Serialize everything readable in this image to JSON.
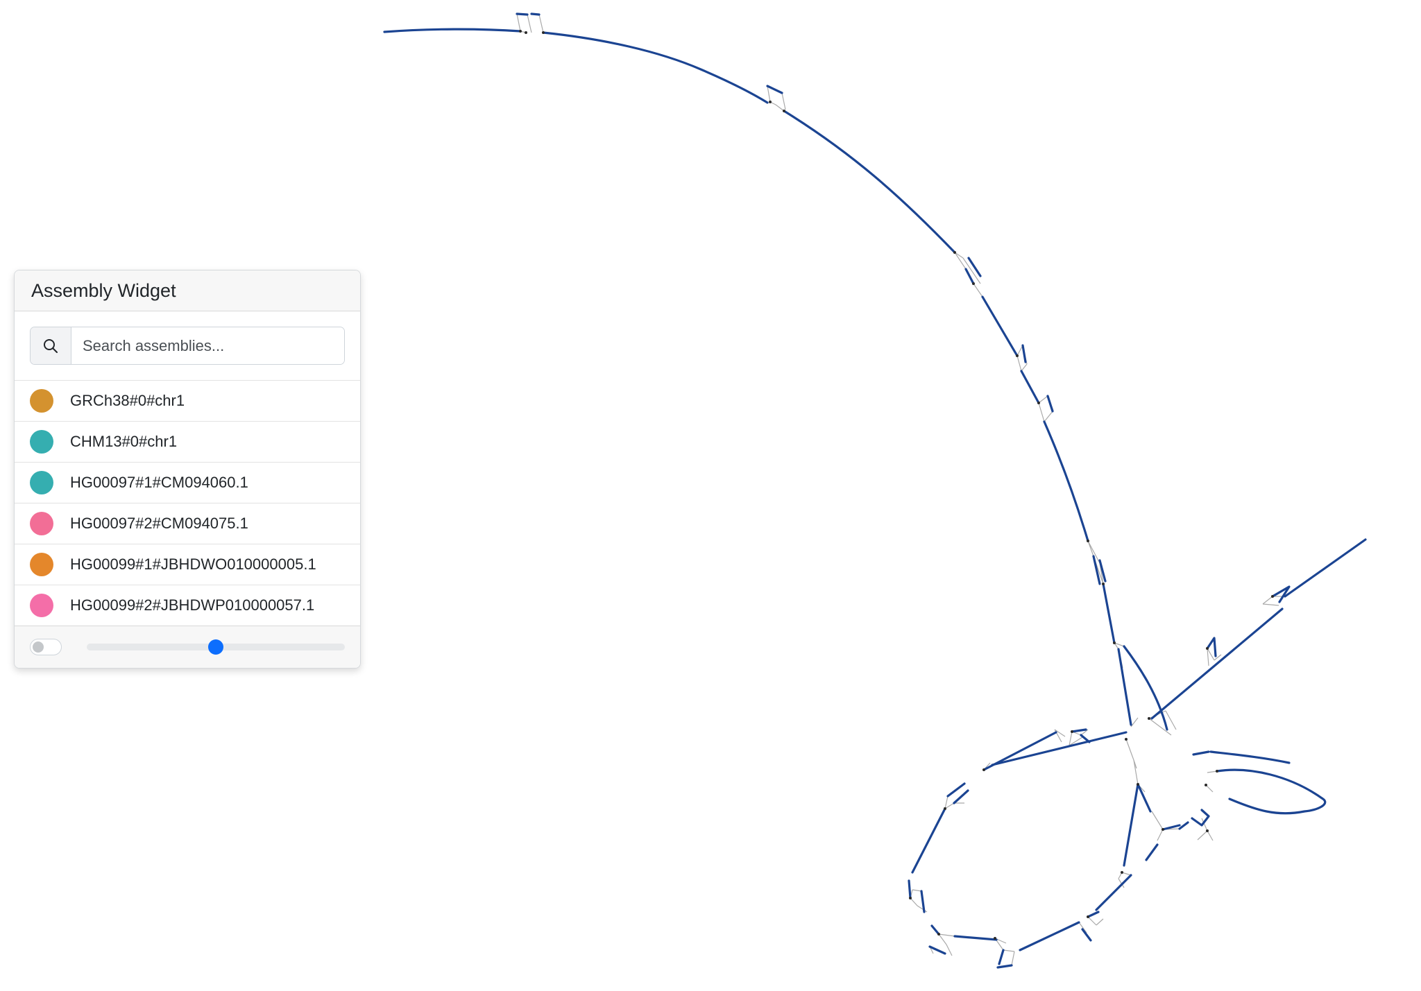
{
  "widget": {
    "title": "Assembly Widget",
    "search": {
      "placeholder": "Search assemblies...",
      "value": "",
      "icon": "search-icon"
    },
    "assemblies": [
      {
        "label": "GRCh38#0#chr1",
        "color": "#d4922f"
      },
      {
        "label": "CHM13#0#chr1",
        "color": "#35aeb0"
      },
      {
        "label": "HG00097#1#CM094060.1",
        "color": "#35aeb0"
      },
      {
        "label": "HG00097#2#CM094075.1",
        "color": "#f26e96"
      },
      {
        "label": "HG00099#1#JBHDWO010000005.1",
        "color": "#e4872b"
      },
      {
        "label": "HG00099#2#JBHDWP010000057.1",
        "color": "#f46ea8"
      }
    ],
    "toggle": {
      "on": false
    },
    "slider": {
      "value": 0.5
    }
  },
  "graph": {
    "node_color": "#1b4492",
    "link_color": "#a9a9a9"
  }
}
